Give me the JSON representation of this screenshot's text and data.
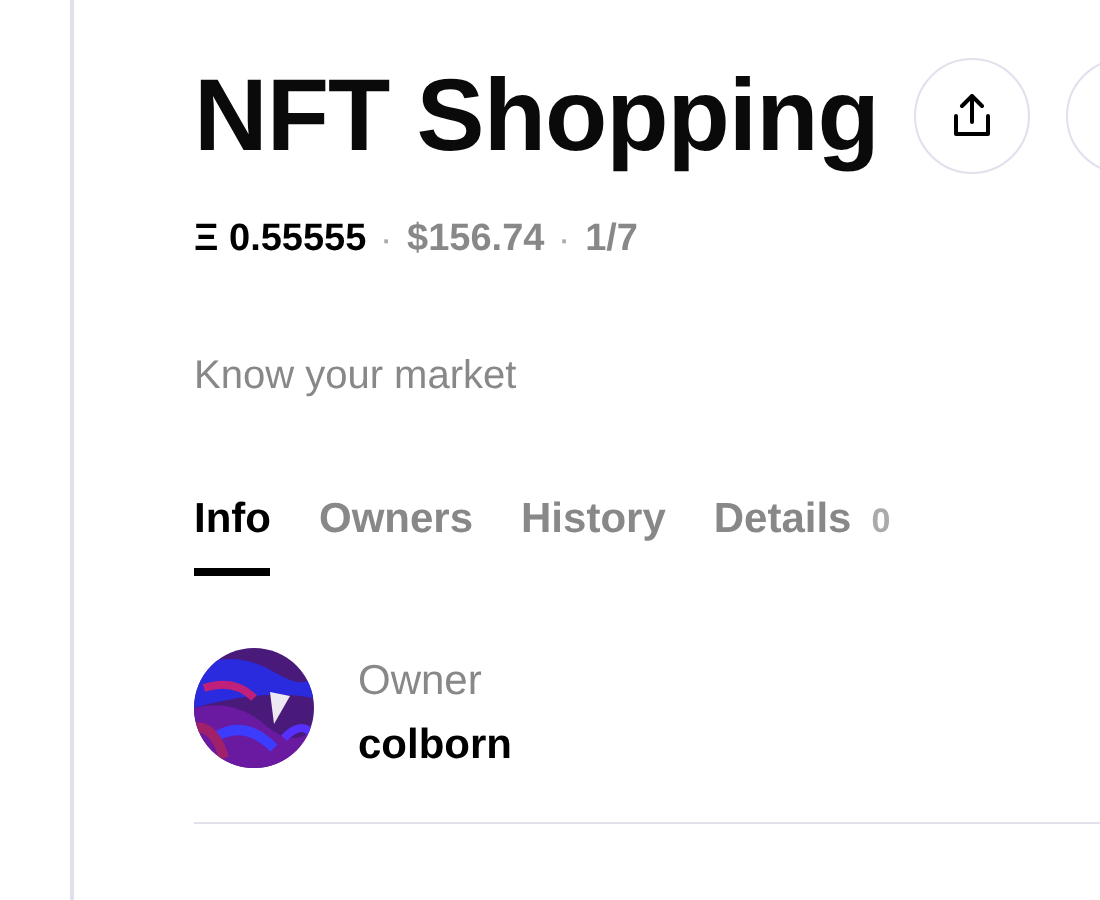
{
  "title": "NFT Shopping",
  "price": {
    "eth": "Ξ 0.55555",
    "usd": "$156.74",
    "edition": "1/7",
    "separator": "·"
  },
  "subtitle": "Know your market",
  "tabs": [
    {
      "label": "Info",
      "selected": true
    },
    {
      "label": "Owners",
      "selected": false
    },
    {
      "label": "History",
      "selected": false
    },
    {
      "label": "Details",
      "selected": false,
      "count": "0"
    }
  ],
  "owner": {
    "label": "Owner",
    "name": "colborn"
  }
}
